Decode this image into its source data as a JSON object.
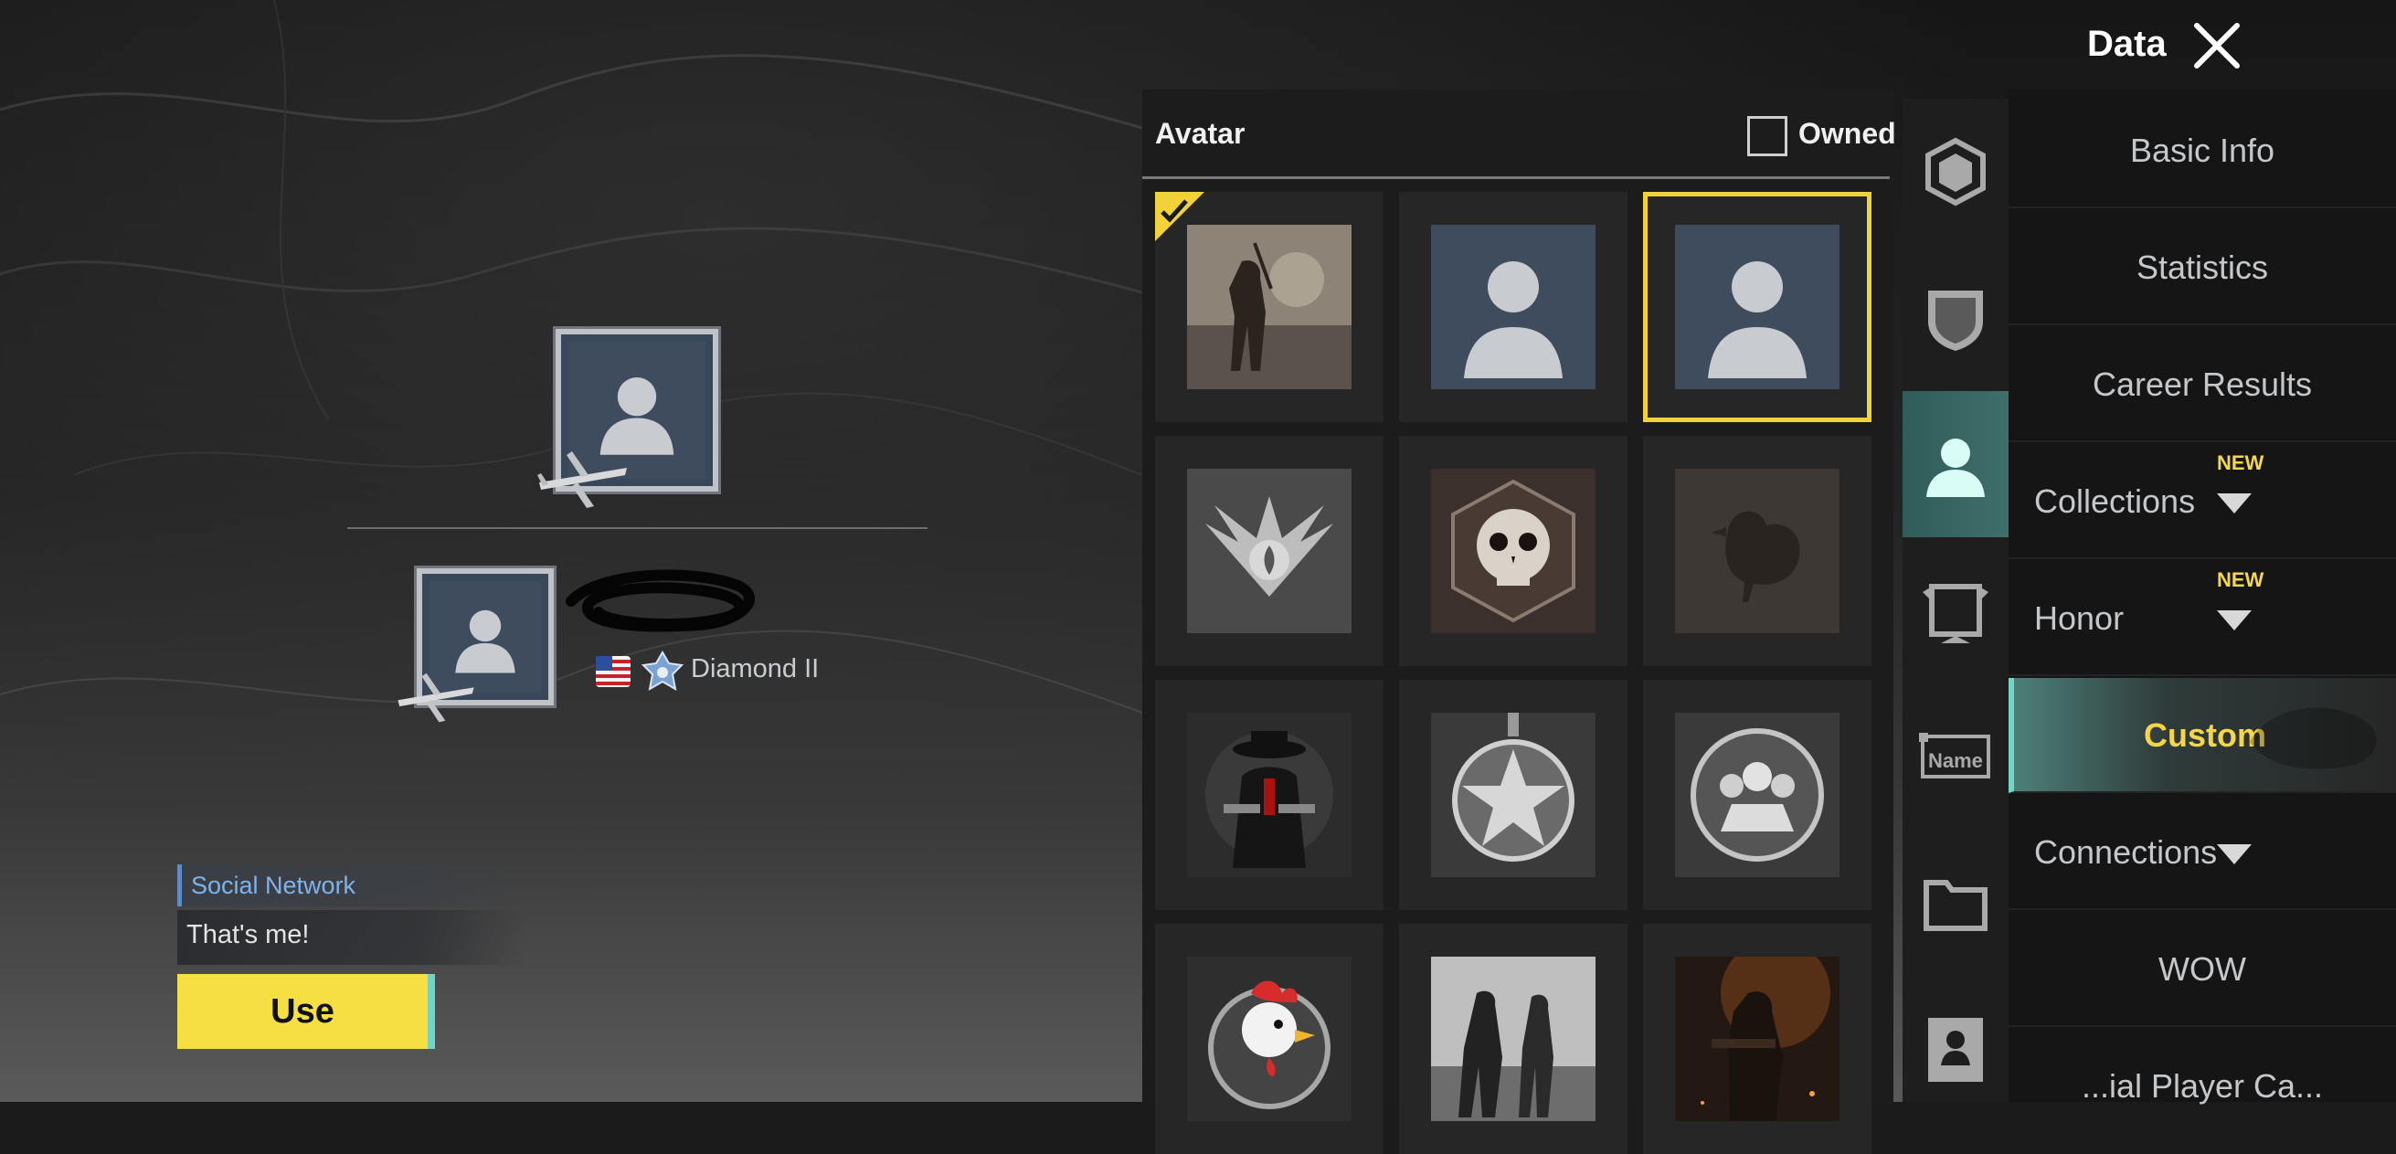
{
  "header": {
    "title": "Data"
  },
  "panel": {
    "title": "Avatar",
    "owned_filter": {
      "label": "Owned",
      "checked": false
    }
  },
  "avatars": [
    {
      "icon": "soldier-silhouette-avatar",
      "equipped": true,
      "selected": false
    },
    {
      "icon": "default-profile-avatar",
      "equipped": false,
      "selected": false
    },
    {
      "icon": "default-profile-avatar",
      "equipped": false,
      "selected": true
    },
    {
      "icon": "winged-flame-emblem-avatar",
      "equipped": false,
      "selected": false
    },
    {
      "icon": "skull-emblem-avatar",
      "equipped": false,
      "selected": false
    },
    {
      "icon": "chicken-emblem-avatar",
      "equipped": false,
      "selected": false
    },
    {
      "icon": "gunslinger-avatar",
      "equipped": false,
      "selected": false
    },
    {
      "icon": "star-medal-avatar",
      "equipped": false,
      "selected": false
    },
    {
      "icon": "squad-emblem-avatar",
      "equipped": false,
      "selected": false
    },
    {
      "icon": "rooster-emblem-avatar",
      "equipped": false,
      "selected": false
    },
    {
      "icon": "duo-agents-avatar",
      "equipped": false,
      "selected": false
    },
    {
      "icon": "fire-soldier-avatar",
      "equipped": false,
      "selected": false
    }
  ],
  "categories": [
    {
      "icon": "badge-icon",
      "active": false
    },
    {
      "icon": "shield-icon",
      "active": false
    },
    {
      "icon": "avatar-icon",
      "active": true
    },
    {
      "icon": "frame-icon",
      "active": false
    },
    {
      "icon": "nameplate-icon",
      "label": "Name",
      "active": false
    },
    {
      "icon": "folder-icon",
      "active": false
    },
    {
      "icon": "id-card-icon",
      "active": false
    }
  ],
  "menu": [
    {
      "label": "Basic Info",
      "new": false,
      "expandable": false,
      "active": false
    },
    {
      "label": "Statistics",
      "new": false,
      "expandable": false,
      "active": false
    },
    {
      "label": "Career Results",
      "new": false,
      "expandable": false,
      "active": false
    },
    {
      "label": "Collections",
      "new": true,
      "new_label": "NEW",
      "expandable": true,
      "active": false
    },
    {
      "label": "Honor",
      "new": true,
      "new_label": "NEW",
      "expandable": true,
      "active": false
    },
    {
      "label": "Custom",
      "new": false,
      "expandable": false,
      "active": true
    },
    {
      "label": "Connections",
      "new": false,
      "expandable": true,
      "active": false
    },
    {
      "label": "WOW",
      "new": false,
      "expandable": false,
      "active": false
    },
    {
      "label": "...ial Player Ca...",
      "new": false,
      "expandable": false,
      "active": false
    }
  ],
  "preview": {
    "rank": "Diamond II",
    "flag": "us-flag-icon"
  },
  "social": {
    "heading": "Social Network",
    "text": "That's me!"
  },
  "use_button": {
    "label": "Use"
  },
  "colors": {
    "accent_yellow": "#f6df43",
    "accent_teal": "#6fd6c7",
    "selected_border": "#f2d23a",
    "new_badge": "#f4d84a"
  }
}
